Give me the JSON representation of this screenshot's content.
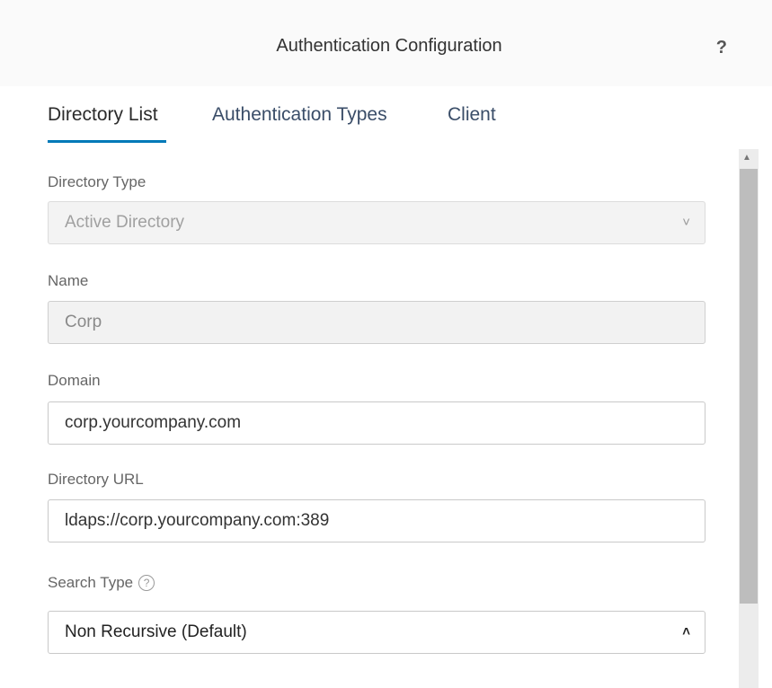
{
  "dialog": {
    "title": "Authentication Configuration",
    "help_label": "?"
  },
  "tabs": [
    {
      "label": "Directory List",
      "active": true
    },
    {
      "label": "Authentication Types",
      "active": false
    },
    {
      "label": "Client",
      "active": false
    }
  ],
  "form": {
    "directory_type": {
      "label": "Directory Type",
      "value": "Active Directory",
      "disabled": true
    },
    "name": {
      "label": "Name",
      "value": "Corp",
      "readonly": true
    },
    "domain": {
      "label": "Domain",
      "value": "corp.yourcompany.com"
    },
    "directory_url": {
      "label": "Directory URL",
      "value": "ldaps://corp.yourcompany.com:389"
    },
    "search_type": {
      "label": "Search Type",
      "help": "?",
      "value": "Non Recursive (Default)"
    }
  },
  "icons": {
    "directory_type_chevron": "˅",
    "search_type_chevron": "˄",
    "scroll_up": "▲"
  },
  "colors": {
    "accent": "#0079b8",
    "tab_text": "#3a4d68"
  }
}
